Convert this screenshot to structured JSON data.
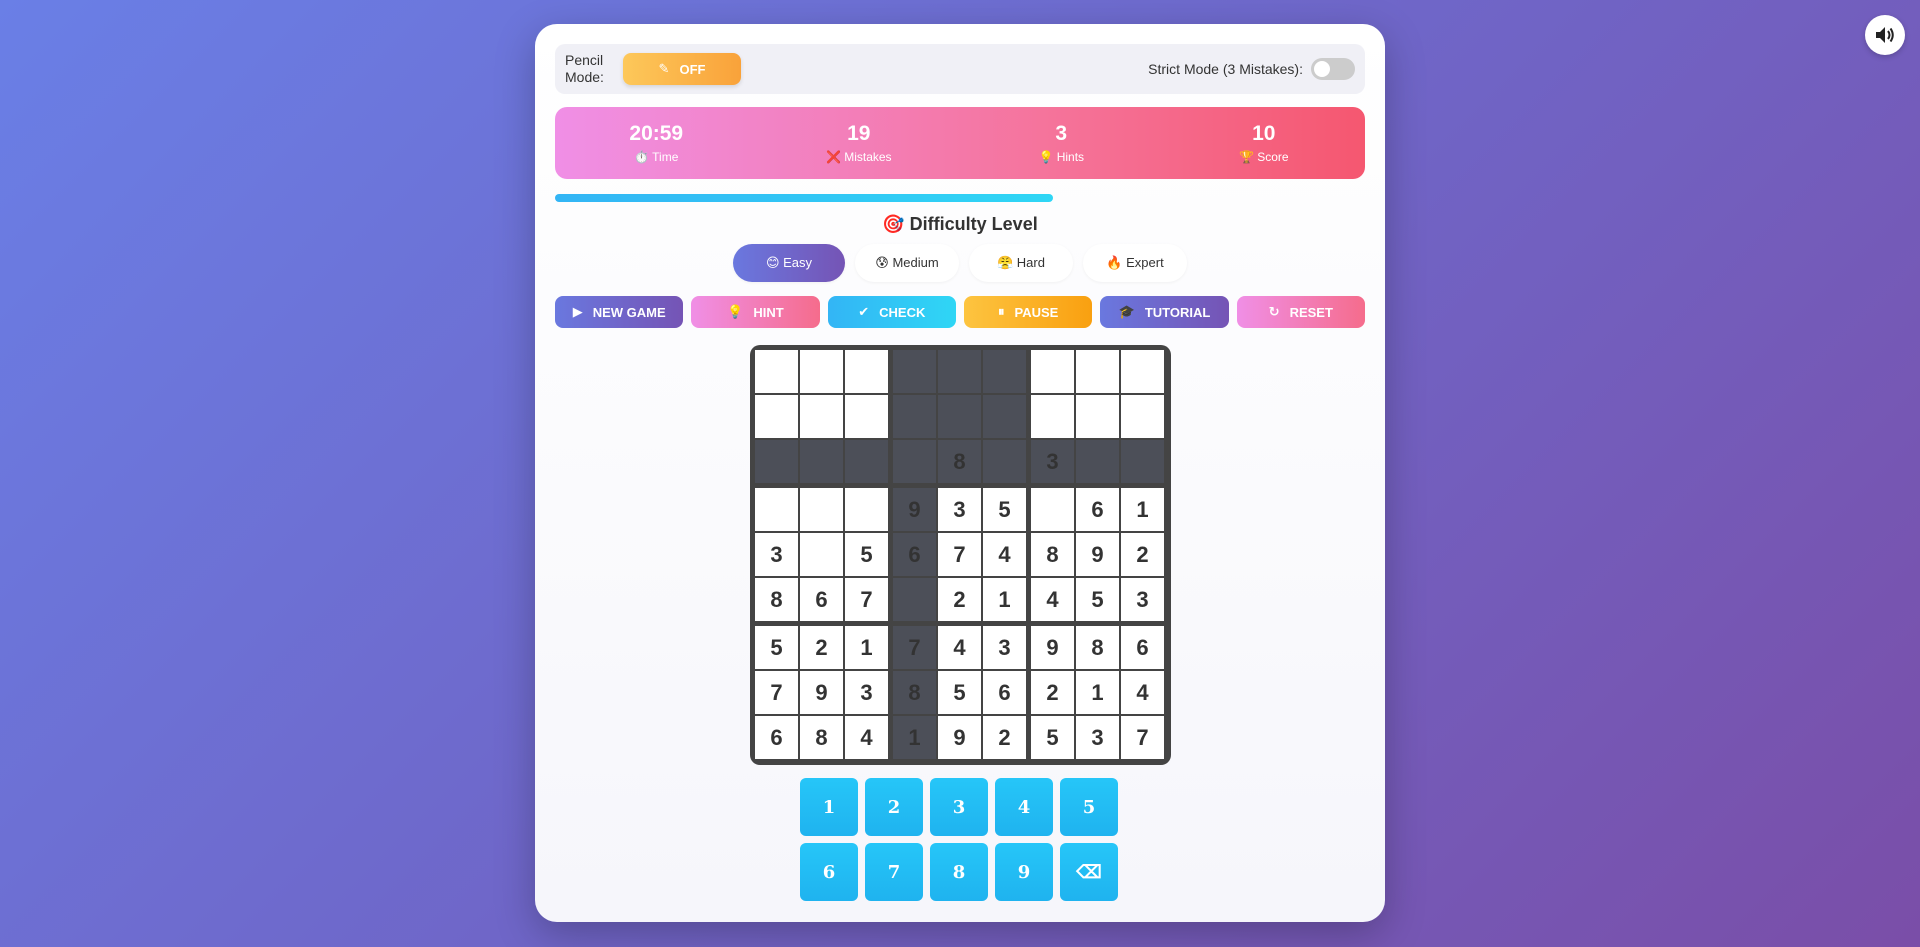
{
  "sound": {
    "icon": "speaker-icon"
  },
  "topbar": {
    "pencil_label": "Pencil Mode:",
    "pencil_state": "OFF",
    "strict_label": "Strict Mode (3 Mistakes):",
    "strict_on": false
  },
  "stats": [
    {
      "value": "20:59",
      "label": "⏱️ Time"
    },
    {
      "value": "19",
      "label": "❌ Mistakes"
    },
    {
      "value": "3",
      "label": "💡 Hints"
    },
    {
      "value": "10",
      "label": "🏆 Score"
    }
  ],
  "progress": {
    "fraction": 0.615
  },
  "difficulty": {
    "title": "🎯 Difficulty Level",
    "options": [
      {
        "label": "😊 Easy",
        "active": true
      },
      {
        "label": "😰 Medium",
        "active": false
      },
      {
        "label": "😤 Hard",
        "active": false
      },
      {
        "label": "🔥 Expert",
        "active": false
      }
    ]
  },
  "actions": [
    {
      "label": "NEW GAME",
      "icon": "▶"
    },
    {
      "label": "HINT",
      "icon": "💡"
    },
    {
      "label": "CHECK",
      "icon": "✔"
    },
    {
      "label": "PAUSE",
      "icon": "⏸"
    },
    {
      "label": "TUTORIAL",
      "icon": "🎓"
    },
    {
      "label": "RESET",
      "icon": "↻"
    }
  ],
  "board": [
    [
      "",
      "",
      "",
      "",
      "",
      "",
      "",
      "",
      ""
    ],
    [
      "",
      "",
      "",
      "",
      "",
      "",
      "",
      "",
      ""
    ],
    [
      "",
      "",
      "",
      "",
      "8",
      "",
      "3",
      "",
      ""
    ],
    [
      "",
      "",
      "",
      "9",
      "3",
      "5",
      "",
      "6",
      "1"
    ],
    [
      "3",
      "",
      "5",
      "6",
      "7",
      "4",
      "8",
      "9",
      "2"
    ],
    [
      "8",
      "6",
      "7",
      "",
      "2",
      "1",
      "4",
      "5",
      "3"
    ],
    [
      "5",
      "2",
      "1",
      "7",
      "4",
      "3",
      "9",
      "8",
      "6"
    ],
    [
      "7",
      "9",
      "3",
      "8",
      "5",
      "6",
      "2",
      "1",
      "4"
    ],
    [
      "6",
      "8",
      "4",
      "1",
      "9",
      "2",
      "5",
      "3",
      "7"
    ]
  ],
  "numpad": [
    "1",
    "2",
    "3",
    "4",
    "5",
    "6",
    "7",
    "8",
    "9",
    "⌫"
  ]
}
